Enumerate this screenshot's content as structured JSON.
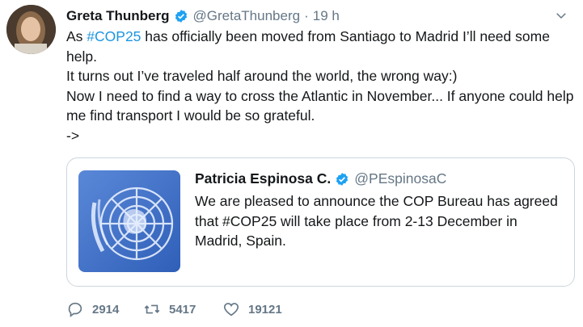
{
  "author": {
    "name": "Greta Thunberg",
    "handle": "@GretaThunberg",
    "separator": "·",
    "time": "19 h"
  },
  "tweet": {
    "line1_pre": "As ",
    "hashtag": "#COP25",
    "line1_post": " has officially been moved from Santiago to Madrid I’ll need some",
    "line2": "help.",
    "line3": "It turns out I’ve traveled half around the world, the wrong way:)",
    "line4": "Now I need to find a way to cross the Atlantic in November... If anyone could help",
    "line5": "me find transport I would be so grateful.",
    "line6": "->"
  },
  "quoted": {
    "name": "Patricia Espinosa C.",
    "handle": "@PEspinosaC",
    "line1": "We are pleased to announce the COP Bureau has agreed",
    "line2": "that #COP25 will take place from 2-13 December in",
    "line3": "Madrid, Spain."
  },
  "stats": {
    "replies": "2914",
    "retweets": "5417",
    "likes": "19121"
  },
  "colors": {
    "verified": "#1da1f2",
    "link": "#1b95e0",
    "muted": "#657786",
    "border": "#ccd6dd"
  },
  "icons": [
    "verified-badge-icon",
    "chevron-down-icon",
    "reply-icon",
    "retweet-icon",
    "like-icon"
  ]
}
